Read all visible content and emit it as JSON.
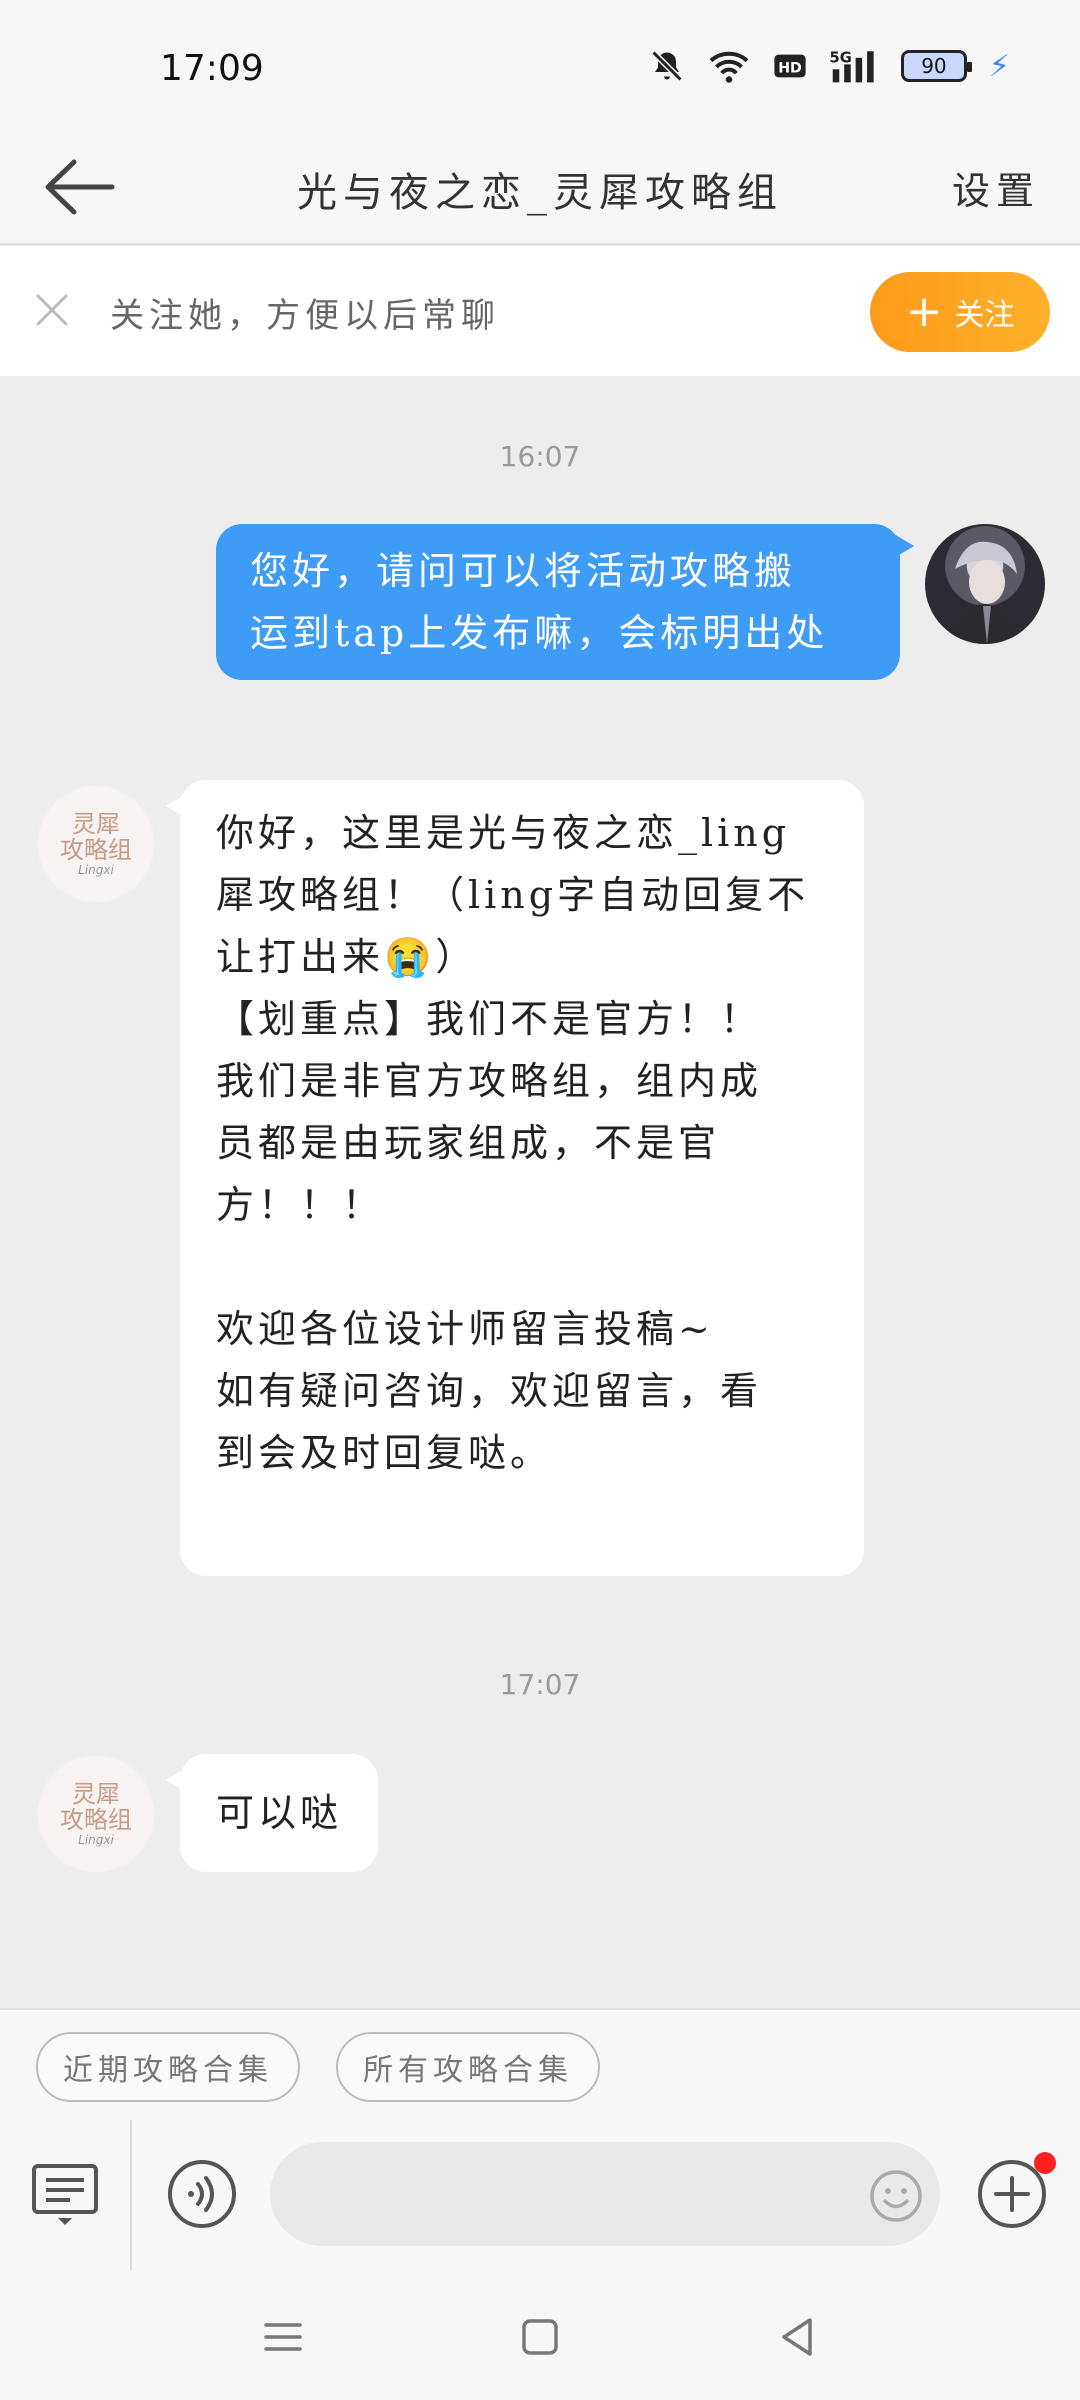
{
  "status_bar": {
    "time": "17:09",
    "battery": "90"
  },
  "header": {
    "title": "光与夜之恋_灵犀攻略组",
    "settings_label": "设置"
  },
  "follow_banner": {
    "text": "关注她，方便以后常聊",
    "button_label": "关注"
  },
  "chat": {
    "timestamp_1": "16:07",
    "outgoing_message": "您好，请问可以将活动攻略搬\n运到tap上发布嘛，会标明出处",
    "incoming_message_1": "你好，这里是光与夜之恋_ling\n犀攻略组！（ling字自动回复不\n让打出来😭）\n【划重点】我们不是官方！！\n我们是非官方攻略组，组内成\n员都是由玩家组成，不是官\n方！！！\n\n欢迎各位设计师留言投稿~\n如有疑问咨询，欢迎留言，看\n到会及时回复哒。",
    "timestamp_2": "17:07",
    "incoming_message_2": "可以哒",
    "group_avatar": {
      "line1": "灵犀",
      "line2": "攻略组",
      "line3": "Lingxi"
    }
  },
  "quick_replies": [
    "近期攻略合集",
    "所有攻略合集"
  ],
  "input": {
    "placeholder": ""
  },
  "colors": {
    "accent_blue": "#3f9cf6",
    "follow_orange": "#ff9a1a",
    "badge_red": "#ff2020"
  }
}
